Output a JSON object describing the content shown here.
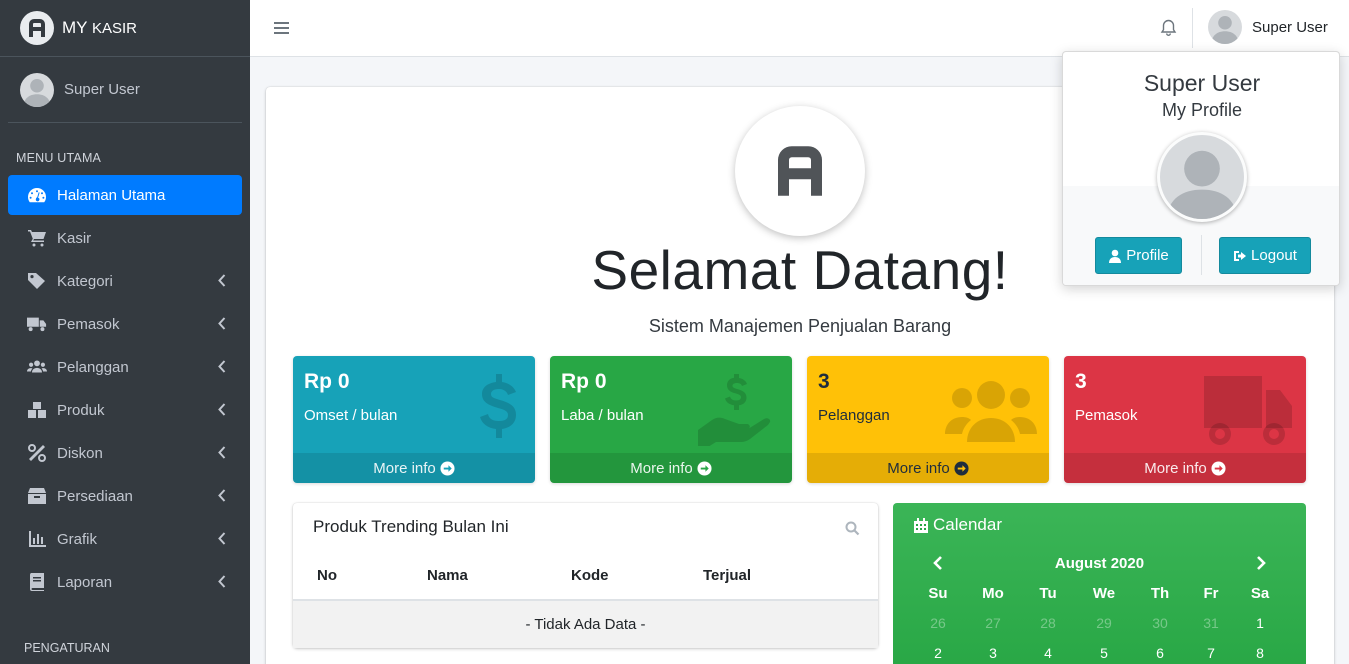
{
  "brand": {
    "title_main": "MY",
    "title_small": "KASIR"
  },
  "sidebar": {
    "user_name": "Super User",
    "header_main": "MENU UTAMA",
    "header_settings": "PENGATURAN",
    "items": [
      {
        "label": "Halaman Utama",
        "icon": "tachometer-icon",
        "active": true
      },
      {
        "label": "Kasir",
        "icon": "cart-icon"
      },
      {
        "label": "Kategori",
        "icon": "tag-icon"
      },
      {
        "label": "Pemasok",
        "icon": "truck-icon"
      },
      {
        "label": "Pelanggan",
        "icon": "users-icon"
      },
      {
        "label": "Produk",
        "icon": "boxes-icon"
      },
      {
        "label": "Diskon",
        "icon": "percent-icon"
      },
      {
        "label": "Persediaan",
        "icon": "box-icon"
      },
      {
        "label": "Grafik",
        "icon": "chart-bar-icon"
      },
      {
        "label": "Laporan",
        "icon": "book-icon"
      }
    ]
  },
  "topbar": {
    "user_name": "Super User"
  },
  "main": {
    "welcome": "Selamat Datang!",
    "subtitle": "Sistem Manajemen Penjualan Barang"
  },
  "stats": [
    {
      "value": "Rp 0",
      "label": "Omset / bulan",
      "footer": "More info",
      "icon": "dollar-icon",
      "color": "#17a2b8"
    },
    {
      "value": "Rp 0",
      "label": "Laba / bulan",
      "footer": "More info",
      "icon": "hand-holding-usd-icon",
      "color": "#28a745"
    },
    {
      "value": "3",
      "label": "Pelanggan",
      "footer": "More info",
      "icon": "users-icon",
      "color": "#ffc107"
    },
    {
      "value": "3",
      "label": "Pemasok",
      "footer": "More info",
      "icon": "truck-icon",
      "color": "#dc3545"
    }
  ],
  "trending": {
    "title": "Produk Trending Bulan Ini",
    "columns": [
      "No",
      "Nama",
      "Kode",
      "Terjual"
    ],
    "empty": "- Tidak Ada Data -"
  },
  "calendar": {
    "title": "Calendar",
    "month": "August 2020",
    "weekdays": [
      "Su",
      "Mo",
      "Tu",
      "We",
      "Th",
      "Fr",
      "Sa"
    ],
    "rows": [
      [
        "26",
        "27",
        "28",
        "29",
        "30",
        "31",
        "1"
      ],
      [
        "2",
        "3",
        "4",
        "5",
        "6",
        "7",
        "8"
      ]
    ]
  },
  "user_dropdown": {
    "name": "Super User",
    "subtitle": "My Profile",
    "profile_button": "Profile",
    "logout_button": "Logout"
  }
}
